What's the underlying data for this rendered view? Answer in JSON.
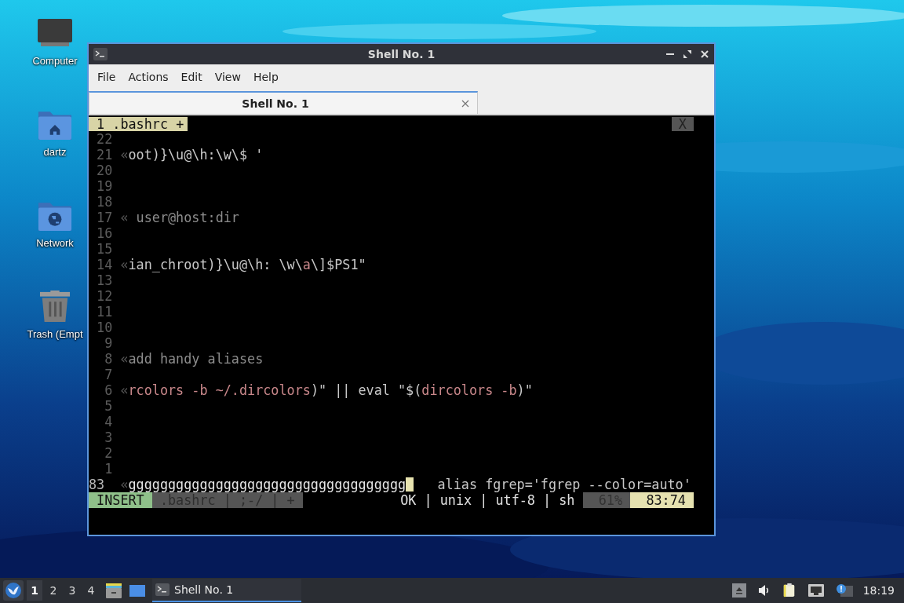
{
  "desktop_icons": [
    {
      "kind": "computer",
      "label": "Computer"
    },
    {
      "kind": "home",
      "label": "dartz"
    },
    {
      "kind": "network",
      "label": "Network"
    },
    {
      "kind": "trash",
      "label": "Trash (Empt"
    }
  ],
  "window": {
    "title": "Shell No. 1"
  },
  "menu": [
    "File",
    "Actions",
    "Edit",
    "View",
    "Help"
  ],
  "tabs": [
    {
      "label": "Shell No. 1",
      "selected": true
    }
  ],
  "editor": {
    "buffer_tab": "1 .bashrc +",
    "close_label": "X",
    "lines": [
      {
        "number": "22",
        "current": false
      },
      {
        "number": "21",
        "current": false,
        "segments": [
          {
            "kind": "marker",
            "text": "«"
          },
          {
            "kind": "plain",
            "text": "oot)}\\u@\\h:\\w\\$ '"
          }
        ]
      },
      {
        "number": "20",
        "current": false
      },
      {
        "number": "19",
        "current": false
      },
      {
        "number": "18",
        "current": false
      },
      {
        "number": "17",
        "current": false,
        "segments": [
          {
            "kind": "marker",
            "text": "«"
          },
          {
            "kind": "comment",
            "text": " user@host:dir"
          }
        ]
      },
      {
        "number": "16",
        "current": false
      },
      {
        "number": "15",
        "current": false
      },
      {
        "number": "14",
        "current": false,
        "segments": [
          {
            "kind": "marker",
            "text": "«"
          },
          {
            "kind": "plain",
            "text": "ian_chroot)}\\u@\\h: \\w\\"
          },
          {
            "kind": "accent",
            "text": "a"
          },
          {
            "kind": "plain",
            "text": "\\]$PS1\""
          }
        ]
      },
      {
        "number": "13",
        "current": false
      },
      {
        "number": "12",
        "current": false
      },
      {
        "number": "11",
        "current": false
      },
      {
        "number": "10",
        "current": false
      },
      {
        "number": "9",
        "current": false
      },
      {
        "number": "8",
        "current": false,
        "segments": [
          {
            "kind": "marker",
            "text": "«"
          },
          {
            "kind": "comment",
            "text": "add handy aliases"
          }
        ]
      },
      {
        "number": "7",
        "current": false
      },
      {
        "number": "6",
        "current": false,
        "segments": [
          {
            "kind": "marker",
            "text": "«"
          },
          {
            "kind": "accent",
            "text": "rcolors -b ~/.dircolors"
          },
          {
            "kind": "plain",
            "text": ")\" || eval \"$("
          },
          {
            "kind": "accent",
            "text": "dircolors -b"
          },
          {
            "kind": "plain",
            "text": ")\""
          }
        ]
      },
      {
        "number": "5",
        "current": false
      },
      {
        "number": "4",
        "current": false
      },
      {
        "number": "3",
        "current": false
      },
      {
        "number": "2",
        "current": false
      },
      {
        "number": "1",
        "current": false
      },
      {
        "number": "83",
        "current": true,
        "segments": [
          {
            "kind": "marker",
            "text": "«"
          },
          {
            "kind": "bright",
            "text": "ggggggggggggggggggggggggggggggggggg"
          },
          {
            "kind": "cursor"
          },
          {
            "kind": "plain",
            "text": "alias fgrep='fgrep --color=auto'"
          }
        ]
      }
    ],
    "status": [
      {
        "kind": "mode",
        "text": "INSERT"
      },
      {
        "kind": "file",
        "text": ".bashrc | ;-/ | +"
      },
      {
        "kind": "info",
        "text": "OK | unix | utf-8 | sh"
      },
      {
        "kind": "percent",
        "text": "61%"
      },
      {
        "kind": "position",
        "text": "83:74"
      }
    ]
  },
  "taskbar": {
    "workspaces": [
      {
        "label": "1",
        "selected": true
      },
      {
        "label": "2",
        "selected": false
      },
      {
        "label": "3",
        "selected": false
      },
      {
        "label": "4",
        "selected": false
      }
    ],
    "tasks": [
      {
        "title": "Shell No. 1",
        "selected": true
      }
    ],
    "clock": "18:19"
  }
}
